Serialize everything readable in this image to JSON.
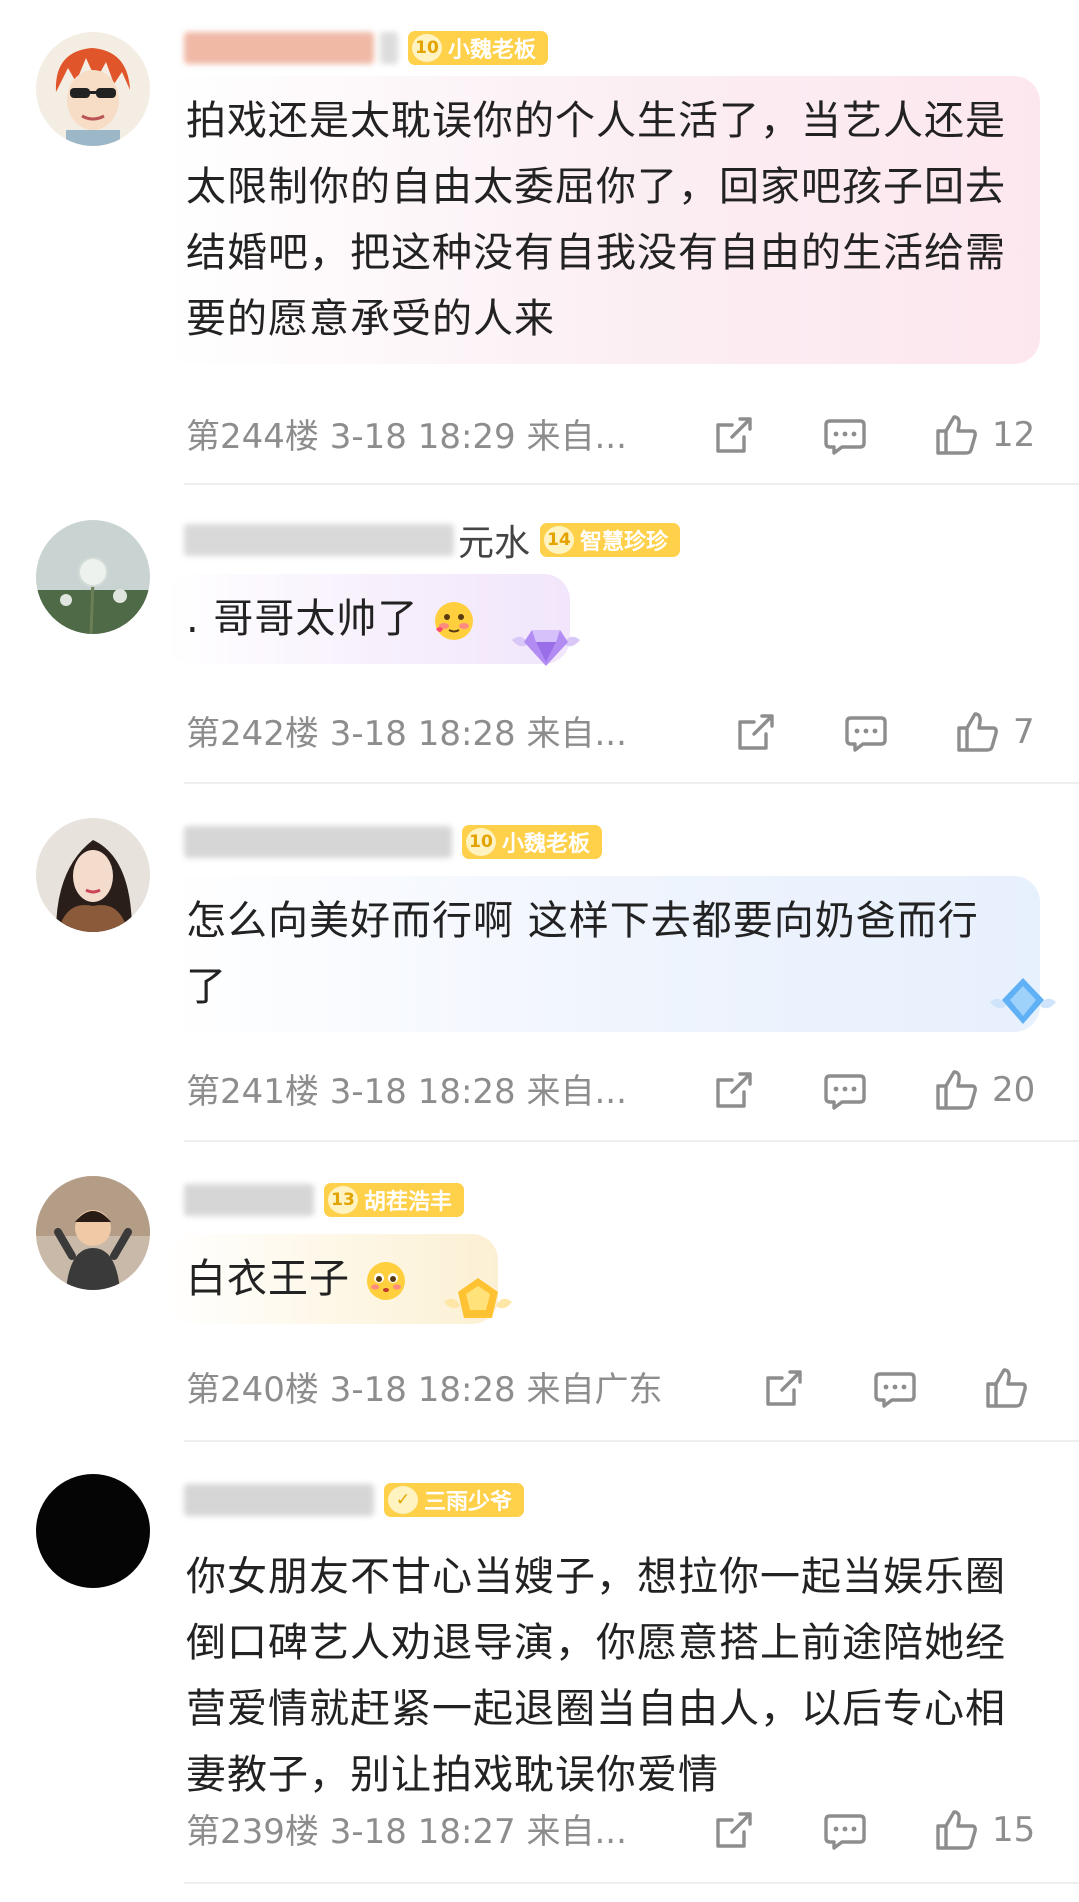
{
  "comments": [
    {
      "user_name_suffix": "",
      "badge_level": "10",
      "badge_name": "小魏老板",
      "text": "拍戏还是太耽误你的个人生活了，当艺人还是太限制你的自由太委屈你了，回家吧孩子回去结婚吧，把这种没有自我没有自由的生活给需要的愿意承受的人来",
      "floor": "第244楼",
      "time": "3-18 18:29",
      "location": "来自...",
      "likes": "12"
    },
    {
      "user_name_suffix": "元水",
      "badge_level": "14",
      "badge_name": "智慧珍珍",
      "text": ". 哥哥太帅了",
      "floor": "第242楼",
      "time": "3-18 18:28",
      "location": "来自...",
      "likes": "7"
    },
    {
      "user_name_suffix": "",
      "badge_level": "10",
      "badge_name": "小魏老板",
      "text": "怎么向美好而行啊 这样下去都要向奶爸而行了",
      "floor": "第241楼",
      "time": "3-18 18:28",
      "location": "来自...",
      "likes": "20"
    },
    {
      "user_name_suffix": "",
      "badge_level": "13",
      "badge_name": "胡茬浩丰",
      "text": "白衣王子",
      "floor": "第240楼",
      "time": "3-18 18:28",
      "location": "来自广东",
      "likes": ""
    },
    {
      "user_name_suffix": "",
      "badge_level": "",
      "badge_name": "三雨少爷",
      "text": "你女朋友不甘心当嫂子，想拉你一起当娱乐圈倒口碑艺人劝退导演，你愿意搭上前途陪她经营爱情就赶紧一起退圈当自由人，以后专心相妻教子，别让拍戏耽误你爱情",
      "floor": "第239楼",
      "time": "3-18 18:27",
      "location": "来自...",
      "likes": "15"
    }
  ],
  "icons": {
    "share": "share-icon",
    "reply": "reply-icon",
    "like": "thumbs-up-icon"
  }
}
